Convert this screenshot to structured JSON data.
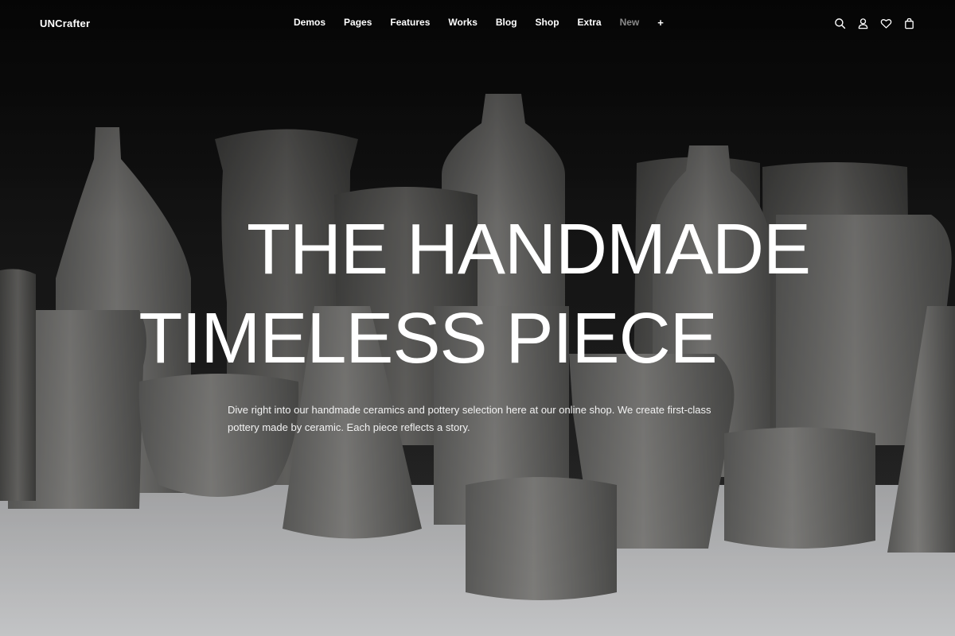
{
  "header": {
    "logo": "UNCrafter",
    "nav": [
      {
        "label": "Demos"
      },
      {
        "label": "Pages"
      },
      {
        "label": "Features"
      },
      {
        "label": "Works"
      },
      {
        "label": "Blog"
      },
      {
        "label": "Shop"
      },
      {
        "label": "Extra"
      },
      {
        "label": "New"
      },
      {
        "label": "+"
      }
    ],
    "icons": [
      "search-icon",
      "user-icon",
      "heart-icon",
      "shopping-bag-icon"
    ]
  },
  "hero": {
    "title_line1": "THE HANDMADE",
    "title_line2": "TIMELESS PIECE",
    "description": "Dive right into our handmade ceramics and pottery selection here at our online shop. We create first-class pottery made by ceramic. Each piece reflects a story."
  },
  "colors": {
    "text": "#ffffff",
    "muted_nav": "#8a8a8a",
    "background_dark": "#141414",
    "table_surface": "#e3e4e6"
  }
}
